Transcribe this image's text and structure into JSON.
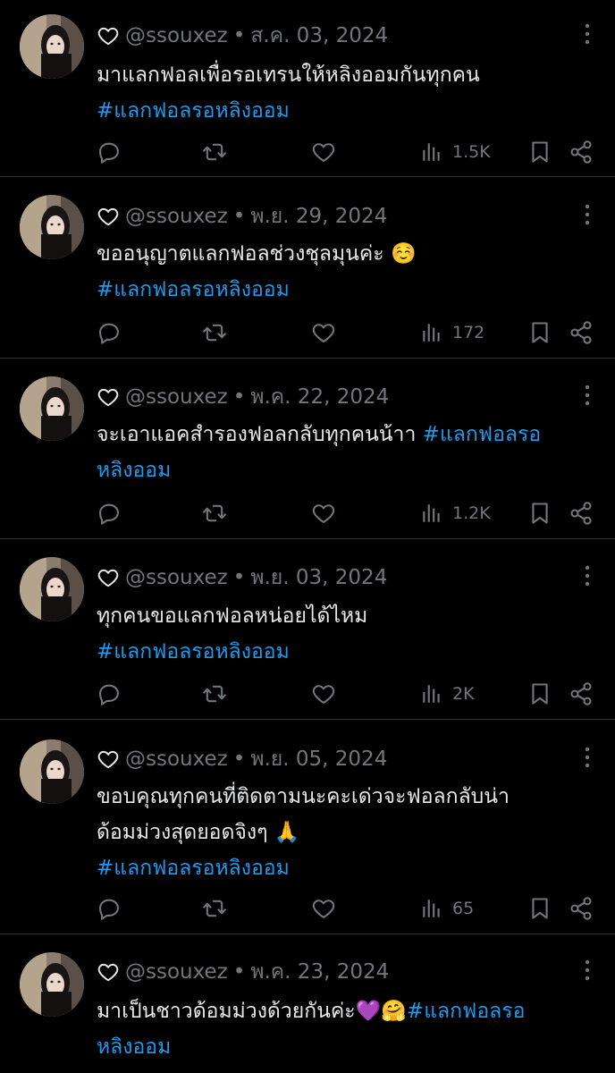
{
  "tweets": [
    {
      "handle": "@ssouxez",
      "date": "ส.ค. 03, 2024",
      "lines": [
        "มาแลกฟอลเพื่อรอเทรนให้หลิงออมกันทุกคน"
      ],
      "hashtag_line": "#แลกฟอลรอหลิงออม",
      "views": "1.5K"
    },
    {
      "handle": "@ssouxez",
      "date": "พ.ย. 29, 2024",
      "lines": [
        "ขออนุญาตแลกฟอลช่วงชุลมุนค่ะ ☺️"
      ],
      "hashtag_line": "#แลกฟอลรอหลิงออม",
      "views": "172"
    },
    {
      "handle": "@ssouxez",
      "date": "พ.ค. 22, 2024",
      "line1_text": "จะเอาแอคสำรองฟอลกลับทุกคนน้าา ",
      "line1_tag": "#แลกฟอลรอ",
      "line2_tag": "หลิงออม",
      "views": "1.2K"
    },
    {
      "handle": "@ssouxez",
      "date": "พ.ย. 03, 2024",
      "lines": [
        "ทุกคนขอแลกฟอลหน่อยได้ไหม"
      ],
      "hashtag_line": "#แลกฟอลรอหลิงออม",
      "views": "2K"
    },
    {
      "handle": "@ssouxez",
      "date": "พ.ย. 05, 2024",
      "lines": [
        "ขอบคุณทุกคนที่ติดตามนะคะเด่วจะฟอลกลับน่า",
        "ด้อมม่วงสุดยอดจิงๆ 🙏"
      ],
      "hashtag_line": "#แลกฟอลรอหลิงออม",
      "views": "65"
    },
    {
      "handle": "@ssouxez",
      "date": "พ.ค. 23, 2024",
      "line1_text": "มาเป็นชาวด้อมม่วงด้วยกันค่ะ💜🤗",
      "line1_tag": "#แลกฟอลรอ",
      "line2_tag": "หลิงออม"
    }
  ],
  "icons": {
    "like_small": "heart-outline-icon",
    "more": "more-vertical-icon",
    "reply": "reply-icon",
    "retweet": "retweet-icon",
    "like": "heart-icon",
    "views": "views-icon",
    "bookmark": "bookmark-icon",
    "share": "share-icon"
  },
  "colors": {
    "background": "#000000",
    "text": "#e7e9ea",
    "muted": "#71767b",
    "link": "#1d9bf0",
    "divider": "#2f3336"
  }
}
